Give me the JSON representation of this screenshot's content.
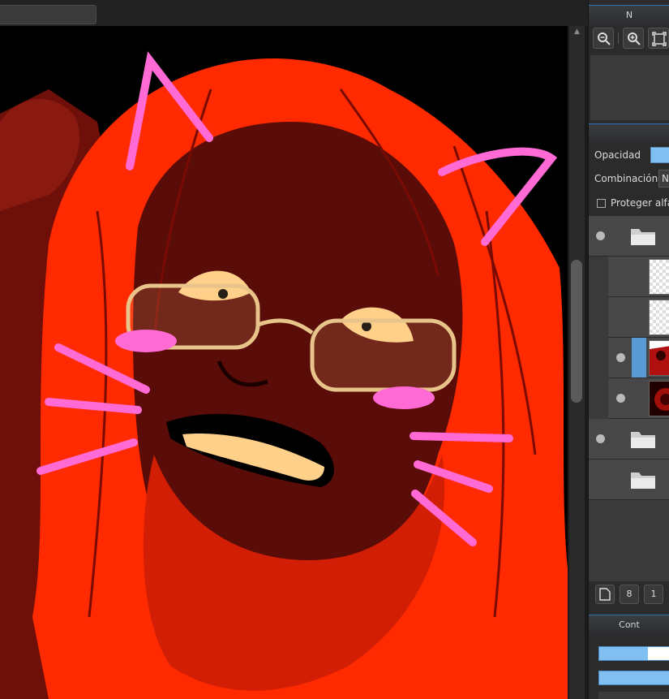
{
  "navigator": {
    "title": "N"
  },
  "layer_props": {
    "opacity_label": "Opacidad",
    "blend_label": "Combinación",
    "blend_value": "N",
    "protect_alpha_label": "Proteger alfa"
  },
  "layers": {
    "rows": [
      {
        "type": "folder",
        "visible": true
      },
      {
        "type": "layer",
        "thumb": "transparent-sketch",
        "visible": false
      },
      {
        "type": "layer",
        "thumb": "transparent-sketch",
        "visible": false
      },
      {
        "type": "layer",
        "thumb": "red-art",
        "visible": true,
        "selected": true
      },
      {
        "type": "layer",
        "thumb": "red-art",
        "visible": true
      },
      {
        "type": "folder",
        "visible": true
      },
      {
        "type": "folder",
        "visible": false
      }
    ],
    "footer_buttons": [
      "new-layer-icon",
      "8",
      "1"
    ]
  },
  "brush_panel": {
    "title": "Cont",
    "slider1_fraction": 0.7
  },
  "colors": {
    "accent": "#7fbff2",
    "canvas_red": "#ff2a00",
    "dark_red": "#5a0c08",
    "pink": "#ff6ad5",
    "skin": "#ffd08a"
  }
}
